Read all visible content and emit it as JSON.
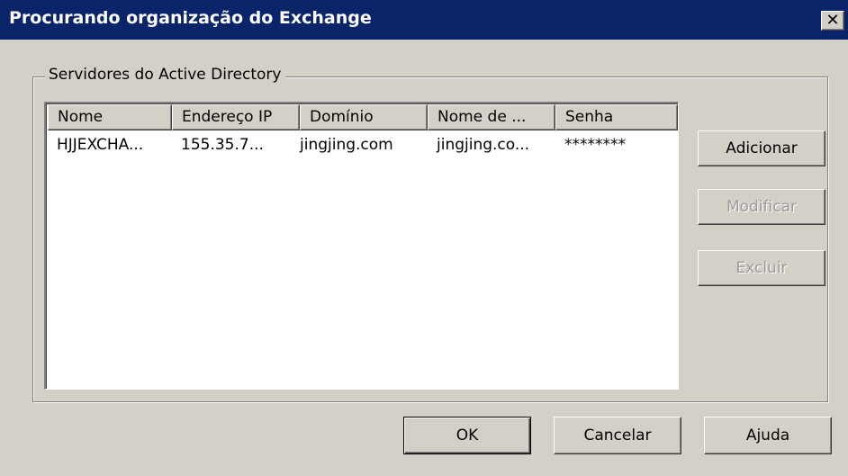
{
  "window": {
    "title": "Procurando organização do Exchange",
    "close_glyph": "✕"
  },
  "group": {
    "label": "Servidores do Active Directory"
  },
  "list": {
    "columns": [
      "Nome",
      "Endereço IP",
      "Domínio",
      "Nome de ...",
      "Senha"
    ],
    "rows": [
      [
        "HJJEXCHA...",
        "155.35.7...",
        "jingjing.com",
        "jingjing.co...",
        "********"
      ]
    ]
  },
  "side_buttons": {
    "add": "Adicionar",
    "modify": "Modificar",
    "delete": "Excluir"
  },
  "footer_buttons": {
    "ok": "OK",
    "cancel": "Cancelar",
    "help": "Ajuda"
  }
}
